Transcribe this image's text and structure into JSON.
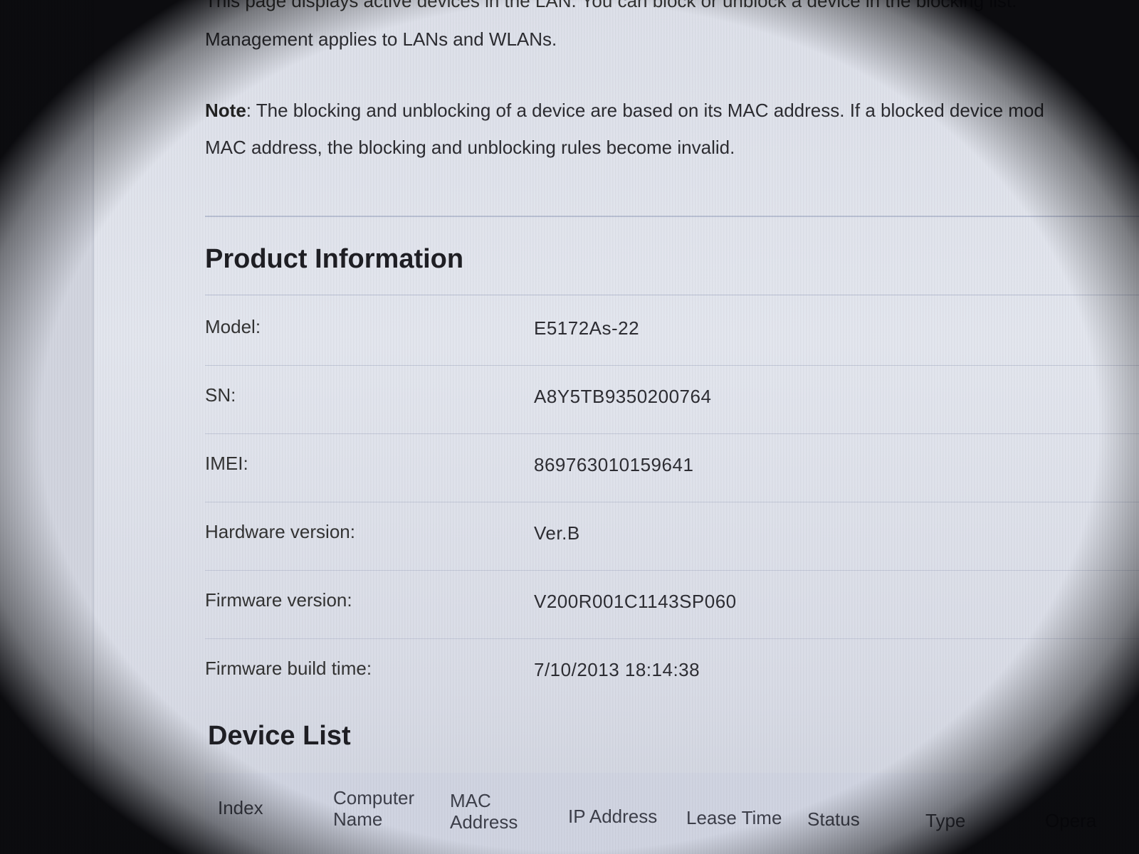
{
  "intro": {
    "line1": "This page displays active devices in the LAN. You can block or unblock a device in the blocking list.",
    "line2": "Management applies to LANs and WLANs."
  },
  "note": {
    "label": "Note",
    "text1": ": The blocking and unblocking of a device are based on its MAC address. If a blocked device mod",
    "text2": "MAC address, the blocking and unblocking rules become invalid."
  },
  "product_info": {
    "title": "Product Information",
    "rows": [
      {
        "label": "Model:",
        "value": "E5172As-22"
      },
      {
        "label": "SN:",
        "value": "A8Y5TB9350200764"
      },
      {
        "label": "IMEI:",
        "value": "869763010159641"
      },
      {
        "label": "Hardware version:",
        "value": "Ver.B"
      },
      {
        "label": "Firmware version:",
        "value": "V200R001C1143SP060"
      },
      {
        "label": "Firmware build time:",
        "value": "7/10/2013 18:14:38"
      }
    ]
  },
  "device_list": {
    "title": "Device List",
    "columns": {
      "index": "Index",
      "computer_name_1": "Computer",
      "computer_name_2": "Name",
      "mac_1": "MAC",
      "mac_2": "Address",
      "ip": "IP Address",
      "lease": "Lease Time",
      "status": "Status",
      "type": "Type",
      "operation": "Opera"
    }
  }
}
